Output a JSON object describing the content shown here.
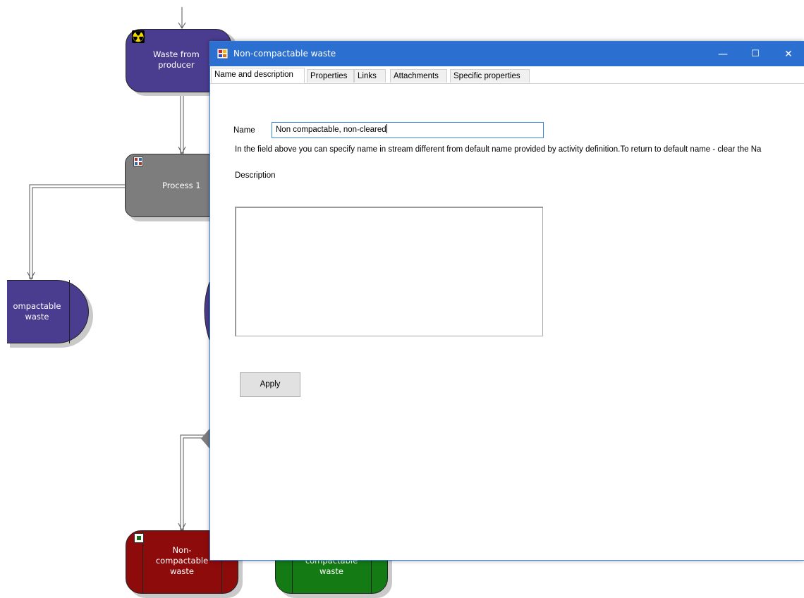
{
  "diagram": {
    "nodes": {
      "waste_from_producer": "Waste from\nproducer",
      "process_1": "Process 1",
      "compactable_waste": "ompactable\nwaste",
      "non_compactable_waste": "Non-\ncompactable\nwaste",
      "bottom_right_waste": "compactable\nwaste"
    },
    "colors": {
      "purple": "#4a3d8f",
      "grey": "#7d7d7d",
      "red": "#8e0b0b",
      "green": "#137a14"
    }
  },
  "dialog": {
    "title": "Non-compactable waste",
    "tabs": [
      "Name and description",
      "Properties",
      "Links",
      "Attachments",
      "Specific properties"
    ],
    "name_label": "Name",
    "name_value": "Non compactable, non-cleared",
    "hint": "In the field above you can specify name in stream different from default name provided by activity definition.To return to default name - clear the Na",
    "description_label": "Description",
    "description_value": "",
    "apply_label": "Apply",
    "window_controls": {
      "minimize": "—",
      "maximize": "☐",
      "close": "✕"
    }
  }
}
